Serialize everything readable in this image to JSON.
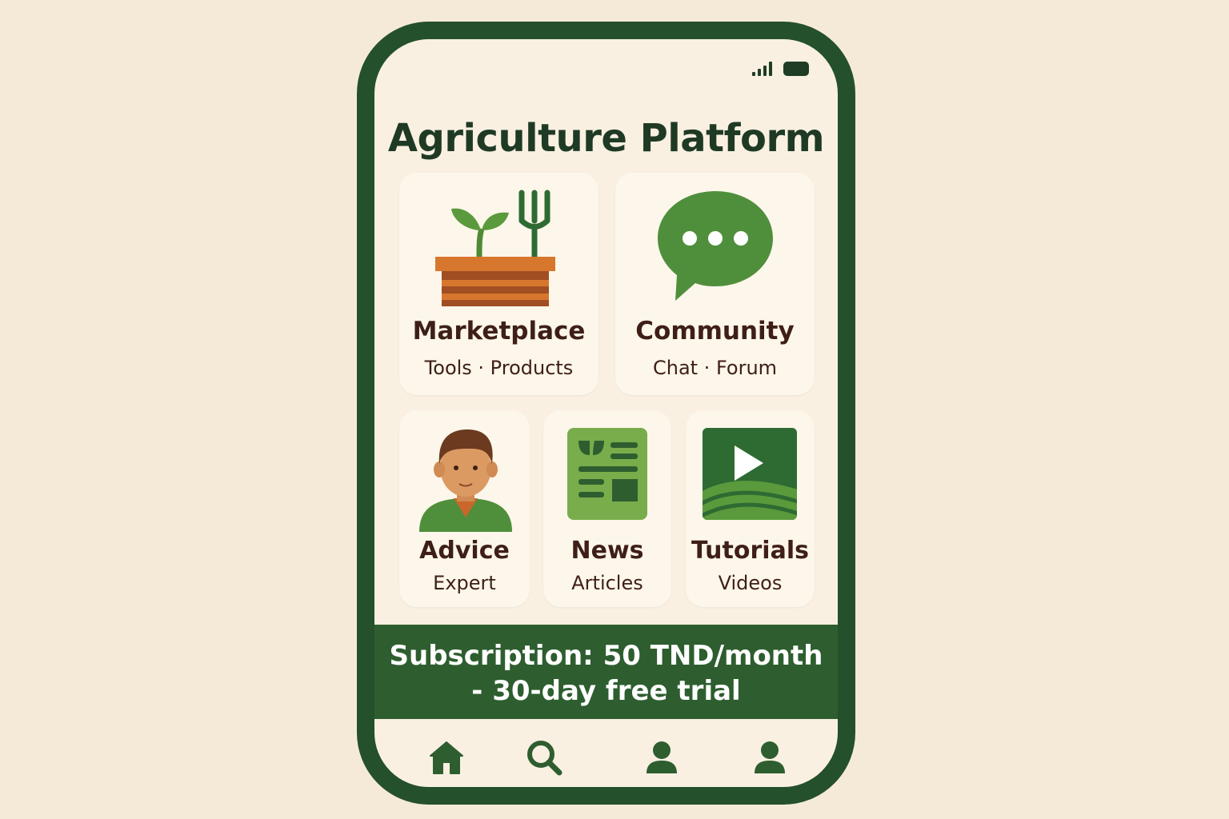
{
  "app": {
    "title": "Agriculture Platform"
  },
  "colors": {
    "primary": "#2e5e2f",
    "frame": "#24502b",
    "accent": "#5a9a3c",
    "brown": "#c9672a",
    "background": "#f5ead8"
  },
  "status_bar": {
    "icons": [
      "signal-icon",
      "battery-icon"
    ]
  },
  "cards": [
    {
      "label": "Marketplace",
      "sub": "Tools · Products",
      "icon": "plant-box-fork-icon"
    },
    {
      "label": "Community",
      "sub": "Chat · Forum",
      "icon": "chat-bubble-icon"
    },
    {
      "label": "Advice",
      "sub": "Expert",
      "icon": "expert-avatar-icon"
    },
    {
      "label": "News",
      "sub": "Articles",
      "icon": "newspaper-icon"
    },
    {
      "label": "Tutorials",
      "sub": "Videos",
      "icon": "video-play-icon"
    }
  ],
  "banner": {
    "line1": "Subscription:  50 TND/month",
    "line2": "- 30-day free trial"
  },
  "bottom_nav": [
    {
      "icon": "home-icon"
    },
    {
      "icon": "search-icon"
    },
    {
      "icon": "user-icon"
    },
    {
      "icon": "profile-icon"
    }
  ]
}
